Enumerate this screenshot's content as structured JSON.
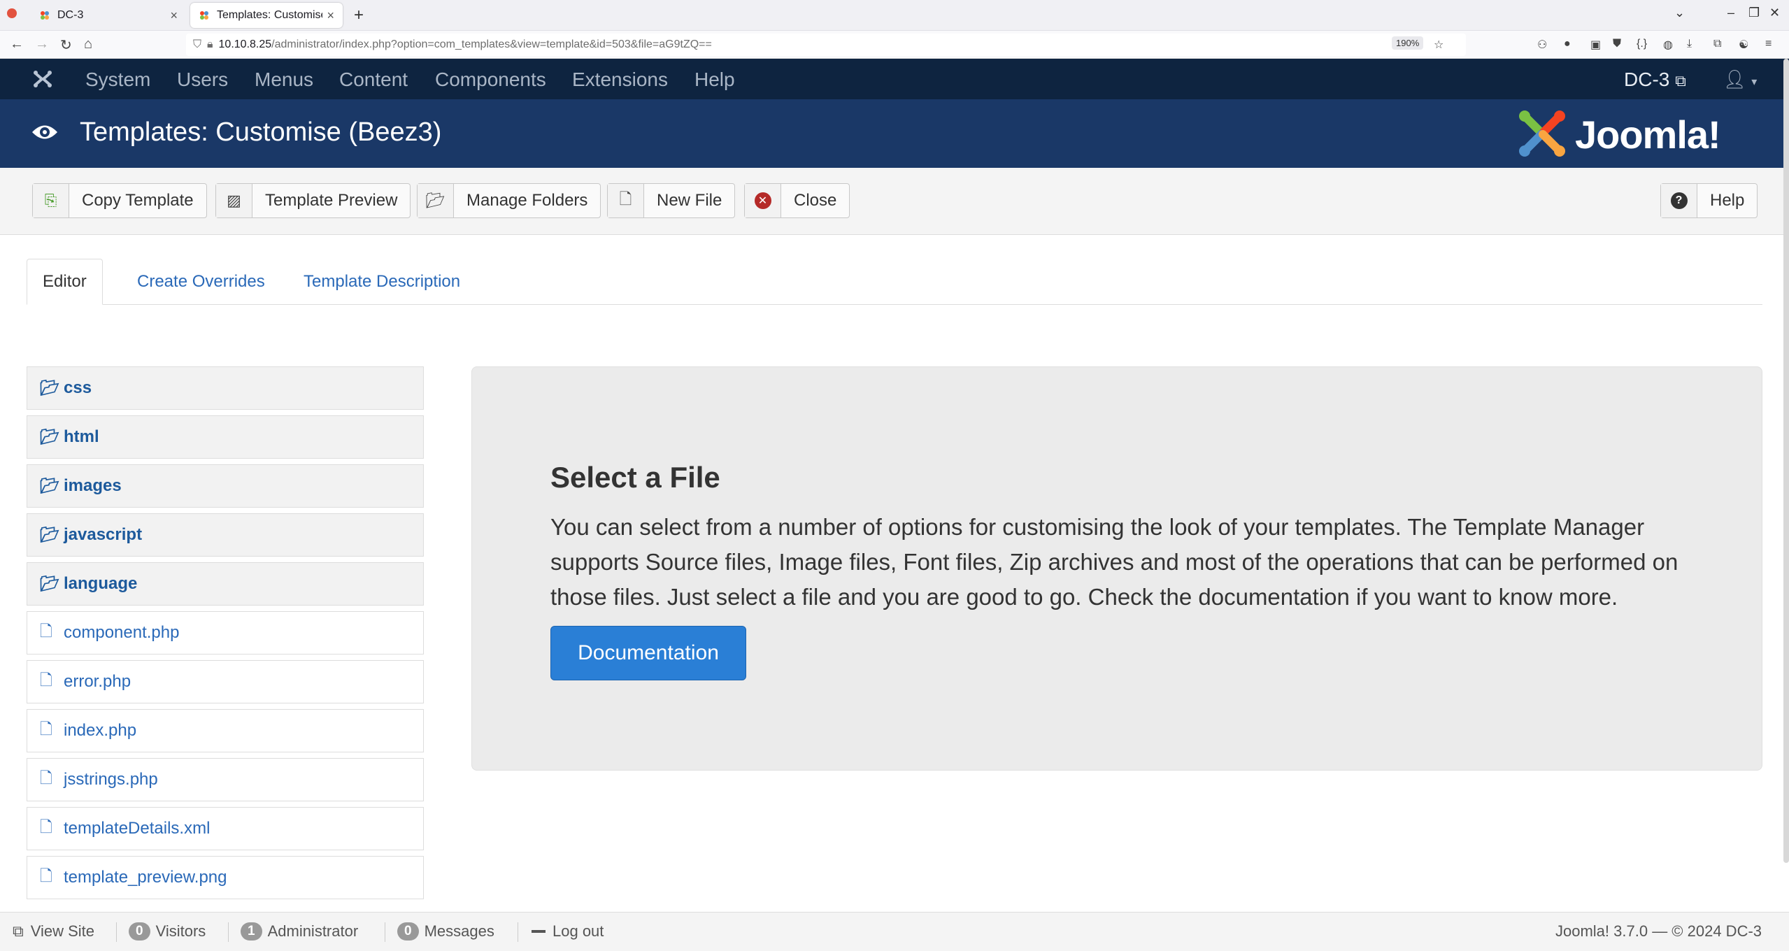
{
  "browser": {
    "tabs": [
      {
        "label": "DC-3",
        "active": false
      },
      {
        "label": "Templates: Customise (Be",
        "active": true
      }
    ],
    "url": {
      "host": "10.10.8.25",
      "path": "/administrator/index.php?option=com_templates&view=template&id=503&file=aG9tZQ=="
    },
    "zoom": "190%"
  },
  "topnav": {
    "items": [
      "System",
      "Users",
      "Menus",
      "Content",
      "Components",
      "Extensions",
      "Help"
    ],
    "site_label": "DC-3"
  },
  "header": {
    "title": "Templates: Customise (Beez3)",
    "brand": "Joomla!"
  },
  "toolbar": {
    "buttons": [
      {
        "label": "Copy Template",
        "icon": "copy-icon"
      },
      {
        "label": "Template Preview",
        "icon": "image-icon"
      },
      {
        "label": "Manage Folders",
        "icon": "folder-open-icon"
      },
      {
        "label": "New File",
        "icon": "file-icon"
      },
      {
        "label": "Close",
        "icon": "close-circle-icon"
      }
    ],
    "help_label": "Help"
  },
  "tabs": [
    "Editor",
    "Create Overrides",
    "Template Description"
  ],
  "tree": {
    "folders": [
      "css",
      "html",
      "images",
      "javascript",
      "language"
    ],
    "files": [
      "component.php",
      "error.php",
      "index.php",
      "jsstrings.php",
      "templateDetails.xml",
      "template_preview.png"
    ]
  },
  "panel": {
    "heading": "Select a File",
    "body": "You can select from a number of options for customising the look of your templates. The Template Manager supports Source files, Image files, Font files, Zip archives and most of the operations that can be performed on those files. Just select a file and you are good to go. Check the documentation if you want to know more.",
    "button": "Documentation"
  },
  "status": {
    "view_site": "View Site",
    "visitors_count": "0",
    "visitors_label": "Visitors",
    "admin_count": "1",
    "admin_label": "Administrator",
    "messages_count": "0",
    "messages_label": "Messages",
    "logout": "Log out",
    "footer": "Joomla! 3.7.0  —  © 2024 DC-3"
  },
  "colors": {
    "nav_bg": "#0e2440",
    "header_bg": "#1a3867",
    "link": "#2a69b8",
    "primary_button": "#2a7fd6"
  }
}
